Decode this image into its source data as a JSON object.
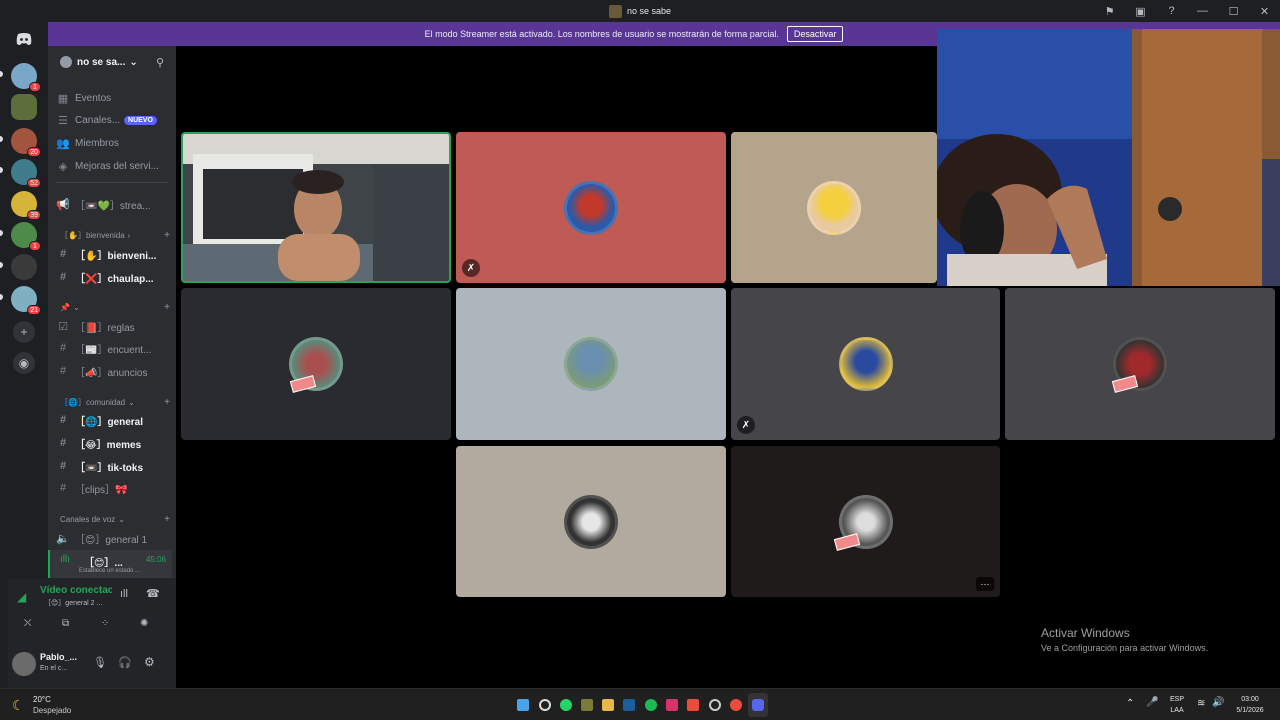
{
  "window": {
    "title": "no se sabe",
    "controls": [
      "⚑",
      "▣",
      "?",
      "—",
      "☐",
      "✕"
    ]
  },
  "rail": {
    "badges": [
      "1",
      "20",
      "52",
      "39",
      "1",
      "21"
    ]
  },
  "banner": {
    "text": "El modo Streamer está activado. Los nombres de usuario se mostrarán de forma parcial.",
    "button": "Desactivar"
  },
  "server": {
    "name": "no se sa...",
    "chevron": "⌄"
  },
  "menu": {
    "events": "Eventos",
    "channels": "Canales...",
    "new_badge": "NUEVO",
    "members": "Miembros",
    "boosts": "Mejoras del servi..."
  },
  "channels": {
    "stream": "［📼💚］strea...",
    "cat_welcome": "［✋］bienvenida",
    "welcome": "［✋］bienveni...",
    "chaulap": "［❌］chaulap...",
    "cat_pin": "📌",
    "rules": "［📕］reglas",
    "surveys": "［📰］encuent...",
    "announcements": "［📣］anuncios",
    "cat_community": "［🌐］comunidad",
    "general": "［🌐］general",
    "memes": "［😂］memes",
    "tiktoks": "［📼］tik-toks",
    "clips": "［clips］🎀",
    "cat_voice": "Canales de voz",
    "voice_general": "［😊］general 1",
    "voice_active": "［😊］...",
    "voice_time": "45:06",
    "voice_status": "Establece un estado ..."
  },
  "voice": {
    "status": "Vídeo conectac",
    "channel": "［😊］general 2 ..."
  },
  "user": {
    "name": "Pablo_...",
    "status": "En el c..."
  },
  "watermark": {
    "title": "Activar Windows",
    "subtitle": "Ve a Configuración para activar Windows."
  },
  "taskbar": {
    "temp": "20°C",
    "weather": "Despejado",
    "lang1": "ESP",
    "lang2": "LAA",
    "time": "03:00",
    "date": "5/1/2026"
  },
  "colors": {
    "banner": "#593695",
    "sidebar": "#2b2d31",
    "rail": "#1e1f22",
    "speaking": "#23a55a",
    "tile_red": "#c05a55",
    "tile_tan": "#b5a48c",
    "tile_grey": "#2a2b30"
  }
}
